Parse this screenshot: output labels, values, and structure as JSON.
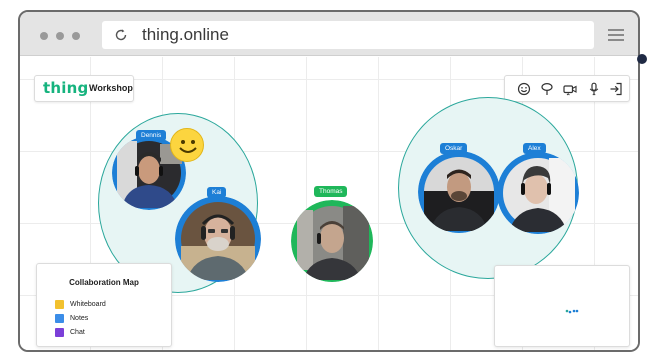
{
  "browser": {
    "url": "thing.online",
    "icons": [
      "dot-icon",
      "reload-icon",
      "menu-icon"
    ]
  },
  "app": {
    "logo": "thing",
    "space_title": "Workshop",
    "brand_color": "#16b37e"
  },
  "toolbar": {
    "buttons": [
      "emoji-icon",
      "lasso-icon",
      "camera-icon",
      "microphone-icon",
      "exit-icon"
    ]
  },
  "participants": [
    {
      "name": "Dennis",
      "ring": "blue"
    },
    {
      "name": "Kai",
      "ring": "blue"
    },
    {
      "name": "Thomas",
      "ring": "green"
    },
    {
      "name": "Oskar",
      "ring": "blue"
    },
    {
      "name": "Alex",
      "ring": "blue"
    }
  ],
  "reaction": "smiley-emoji",
  "collaboration_map": {
    "title": "Collaboration Map",
    "items": [
      {
        "label": "Whiteboard",
        "color": "#f2c12e"
      },
      {
        "label": "Notes",
        "color": "#3b8de8"
      },
      {
        "label": "Chat",
        "color": "#7b3fd8"
      }
    ]
  },
  "colors": {
    "space_fill": "#e7f5f4",
    "space_border": "#2aa79b",
    "ring_blue": "#1d7fd6",
    "ring_green": "#1fb75a"
  }
}
